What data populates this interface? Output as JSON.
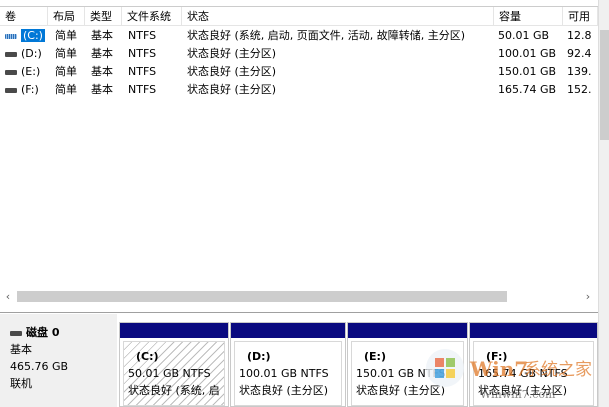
{
  "columns": [
    "卷",
    "布局",
    "类型",
    "文件系统",
    "状态",
    "容量",
    "可用"
  ],
  "volumes": [
    {
      "name": "(C:)",
      "layout": "简单",
      "type": "基本",
      "fs": "NTFS",
      "status": "状态良好 (系统, 启动, 页面文件, 活动, 故障转储, 主分区)",
      "capacity": "50.01 GB",
      "free": "12.8"
    },
    {
      "name": "(D:)",
      "layout": "简单",
      "type": "基本",
      "fs": "NTFS",
      "status": "状态良好 (主分区)",
      "capacity": "100.01 GB",
      "free": "92.4"
    },
    {
      "name": "(E:)",
      "layout": "简单",
      "type": "基本",
      "fs": "NTFS",
      "status": "状态良好 (主分区)",
      "capacity": "150.01 GB",
      "free": "139."
    },
    {
      "name": "(F:)",
      "layout": "简单",
      "type": "基本",
      "fs": "NTFS",
      "status": "状态良好 (主分区)",
      "capacity": "165.74 GB",
      "free": "152."
    }
  ],
  "disk": {
    "name": "磁盘 0",
    "type": "基本",
    "size": "465.76 GB",
    "state": "联机"
  },
  "partitions": [
    {
      "label": "(C:)",
      "size": "50.01 GB NTFS",
      "status": "状态良好 (系统, 启"
    },
    {
      "label": "(D:)",
      "size": "100.01 GB NTFS",
      "status": "状态良好 (主分区)"
    },
    {
      "label": "(E:)",
      "size": "150.01 GB NTFS",
      "status": "状态良好 (主分区)"
    },
    {
      "label": "(F:)",
      "size": "165.74 GB NTFS",
      "status": "状态良好 (主分区)"
    }
  ],
  "scroll": {
    "left": "‹",
    "right": "›"
  },
  "watermark": {
    "text": "Win7系统之家",
    "url": "Winwin7.com"
  }
}
